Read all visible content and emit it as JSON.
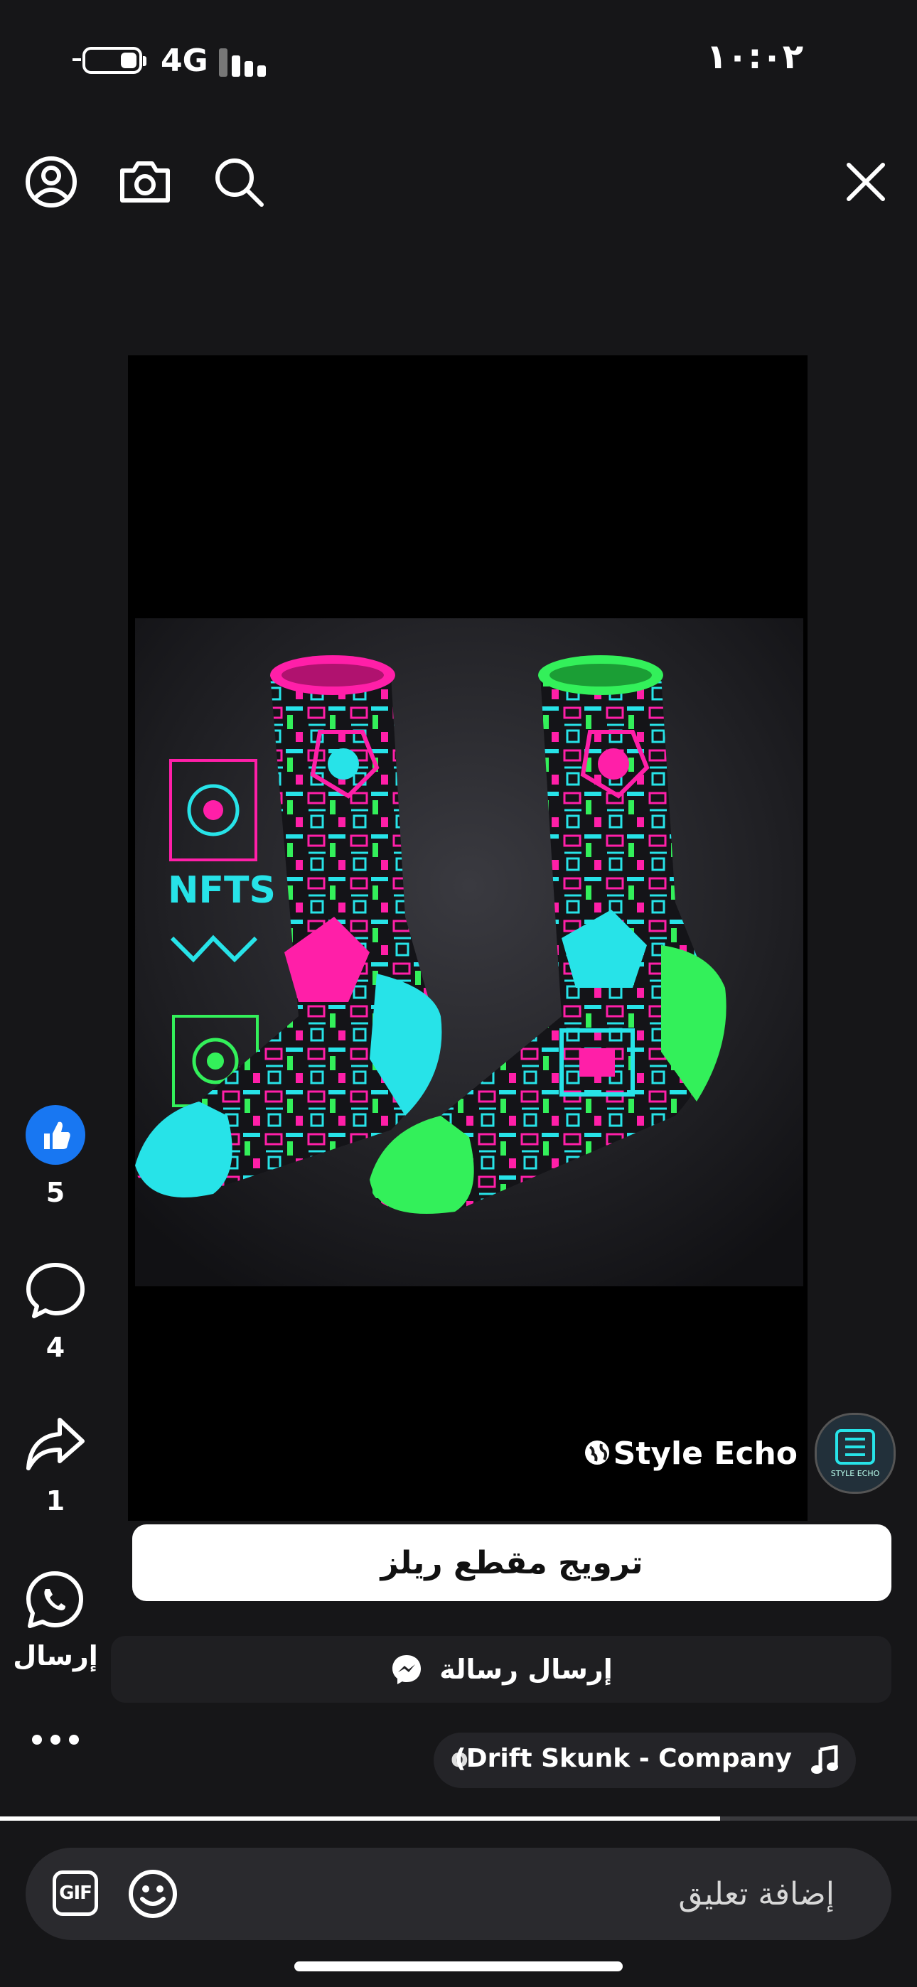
{
  "status_bar": {
    "time": "١٠:٠٢",
    "network": "4G"
  },
  "top_bar": {
    "icons": [
      "profile-icon",
      "camera-icon",
      "search-icon",
      "close-icon"
    ]
  },
  "actions": {
    "likes": "5",
    "comments": "4",
    "shares": "1",
    "send_label": "إرسال",
    "like_color": "#1877F2"
  },
  "author": {
    "name": "Style Echo",
    "avatar_label": "STYLE ECHO"
  },
  "media_text": {
    "nfts_label": "NFTS"
  },
  "buttons": {
    "promote": "ترويج مقطع ريلز",
    "send_message": "إرسال رسالة"
  },
  "music": {
    "track": "(Drift Skunk - Company",
    "trail": "o"
  },
  "progress": {
    "fraction": 0.785
  },
  "comment_bar": {
    "placeholder": "إضافة تعليق",
    "gif_label": "GIF"
  },
  "colors": {
    "pink": "#FF1FA8",
    "green": "#33F05A",
    "cyan": "#27E3E8",
    "background": "#161618"
  }
}
